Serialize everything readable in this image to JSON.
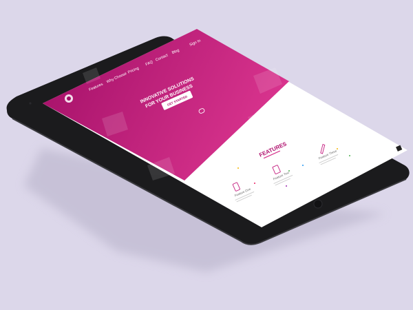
{
  "scene": {
    "background_color": "#dcd7ea",
    "device": "tablet",
    "device_color": "#1b1b1d",
    "screen_colors": {
      "hero_start": "#b0126f",
      "hero_end": "#d6338c",
      "body": "#ffffff"
    }
  },
  "site": {
    "logo_icon": "logo-icon",
    "nav": [
      "Features",
      "Why Choose",
      "Pricing",
      "FAQ",
      "Contact",
      "Blog"
    ],
    "signin_label": "Sign In",
    "hero_title_line1": "INNOVATIVE SOLUTIONS",
    "hero_title_line2": "FOR YOUR BUSINESS",
    "cta_label": "GET STARTED",
    "scroll_icon": "mouse-scroll-icon",
    "features_heading": "FEATURES",
    "features": [
      {
        "icon": "phone-icon",
        "title": "Feature One"
      },
      {
        "icon": "document-icon",
        "title": "Feature Two"
      },
      {
        "icon": "pen-icon",
        "title": "Feature Three"
      }
    ]
  }
}
